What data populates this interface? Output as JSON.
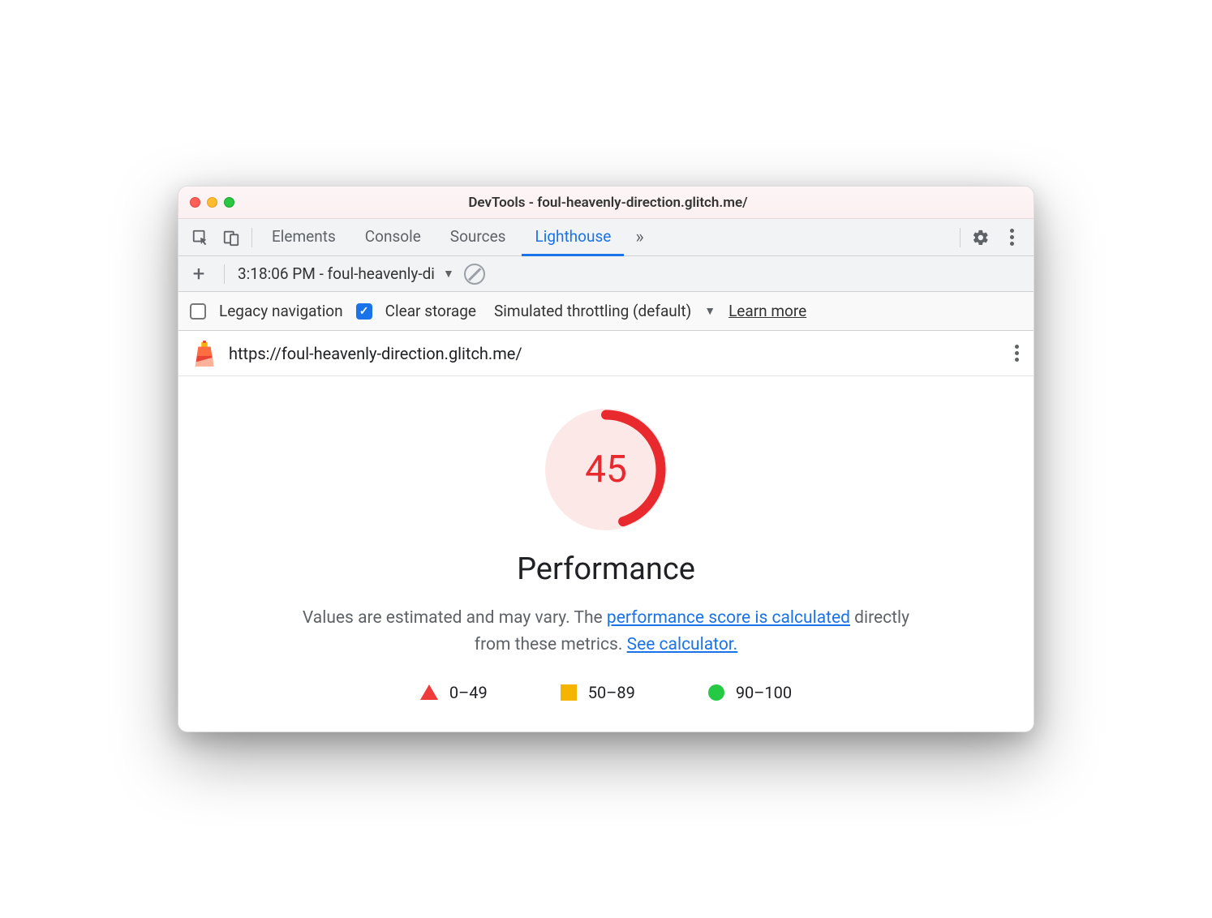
{
  "window": {
    "title": "DevTools - foul-heavenly-direction.glitch.me/"
  },
  "tabs": {
    "elements": "Elements",
    "console": "Console",
    "sources": "Sources",
    "lighthouse": "Lighthouse"
  },
  "toolbar": {
    "report_label": "3:18:06 PM - foul-heavenly-di"
  },
  "options": {
    "legacy_nav": "Legacy navigation",
    "clear_storage": "Clear storage",
    "throttling": "Simulated throttling (default)",
    "learn_more": "Learn more"
  },
  "url_row": {
    "url": "https://foul-heavenly-direction.glitch.me/"
  },
  "report": {
    "score": "45",
    "title": "Performance",
    "desc_prefix": "Values are estimated and may vary. The ",
    "desc_link1": "performance score is calculated",
    "desc_mid": " directly from these metrics. ",
    "desc_link2": "See calculator.",
    "legend": {
      "poor": "0–49",
      "avg": "50–89",
      "good": "90–100"
    }
  }
}
